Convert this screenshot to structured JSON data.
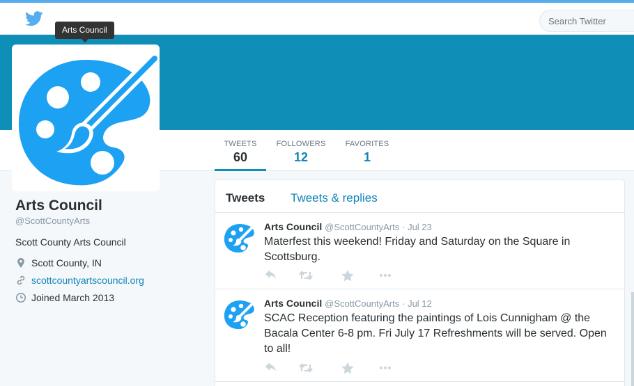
{
  "topbar": {
    "search_placeholder": "Search Twitter",
    "logo_icon": "twitter-bird-icon"
  },
  "tooltip": {
    "text": "Arts Council"
  },
  "colors": {
    "brand": "#55acee",
    "banner": "#0f8fb7",
    "link": "#0f84b8",
    "avatar": "#1da1f2"
  },
  "nav": {
    "stats": [
      {
        "label": "TWEETS",
        "value": "60",
        "active": true
      },
      {
        "label": "FOLLOWERS",
        "value": "12",
        "active": false
      },
      {
        "label": "FAVORITES",
        "value": "1",
        "active": false
      }
    ]
  },
  "profile": {
    "name": "Arts Council",
    "handle": "@ScottCountyArts",
    "bio": "Scott County Arts Council",
    "location": "Scott County, IN",
    "website": "scottcountyartscouncil.org",
    "joined": "Joined March 2013"
  },
  "timeline": {
    "tabs": [
      "Tweets",
      "Tweets & replies"
    ],
    "tweets": [
      {
        "name": "Arts Council",
        "handle": "@ScottCountyArts",
        "date": "· Jul 23",
        "text": "Materfest this weekend! Friday and Saturday on the Square in Scottsburg."
      },
      {
        "name": "Arts Council",
        "handle": "@ScottCountyArts",
        "date": "· Jul 12",
        "text": "SCAC Reception featuring the paintings of Lois Cunnigham @ the Bacala Center 6-8 pm. Fri July 17  Refreshments will be served. Open to all!"
      }
    ]
  }
}
